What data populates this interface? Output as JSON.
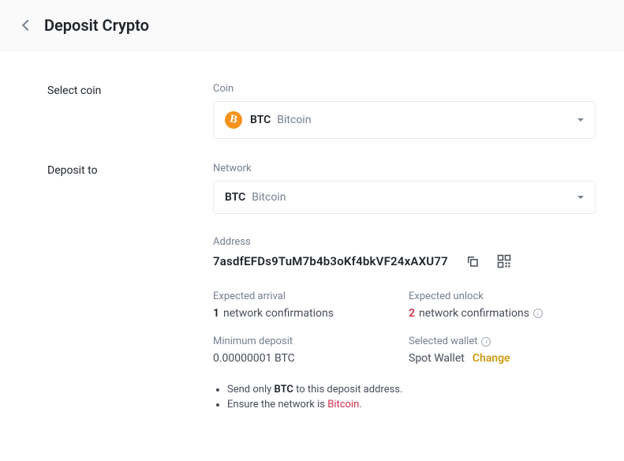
{
  "header": {
    "title": "Deposit Crypto"
  },
  "sections": {
    "select_coin": {
      "label": "Select coin",
      "field_label": "Coin",
      "symbol": "BTC",
      "name": "Bitcoin",
      "icon_glyph": "B"
    },
    "deposit_to": {
      "label": "Deposit to",
      "field_label": "Network",
      "symbol": "BTC",
      "name": "Bitcoin"
    }
  },
  "address": {
    "label": "Address",
    "value": "7asdfEFDs9TuM7b4b3oKf4bkVF24xAXU77"
  },
  "info": {
    "expected_arrival": {
      "label": "Expected arrival",
      "num": "1",
      "suffix": "network confirmations"
    },
    "expected_unlock": {
      "label": "Expected unlock",
      "num": "2",
      "suffix": "network confirmations"
    },
    "min_deposit": {
      "label": "Minimum deposit",
      "value": "0.00000001 BTC"
    },
    "selected_wallet": {
      "label": "Selected wallet",
      "value": "Spot Wallet",
      "change": "Change"
    }
  },
  "notes": {
    "line1_prefix": "Send only ",
    "line1_strong": "BTC",
    "line1_suffix": " to this deposit address.",
    "line2_prefix": "Ensure the network is ",
    "line2_red": "Bitcoin",
    "line2_suffix": "."
  }
}
